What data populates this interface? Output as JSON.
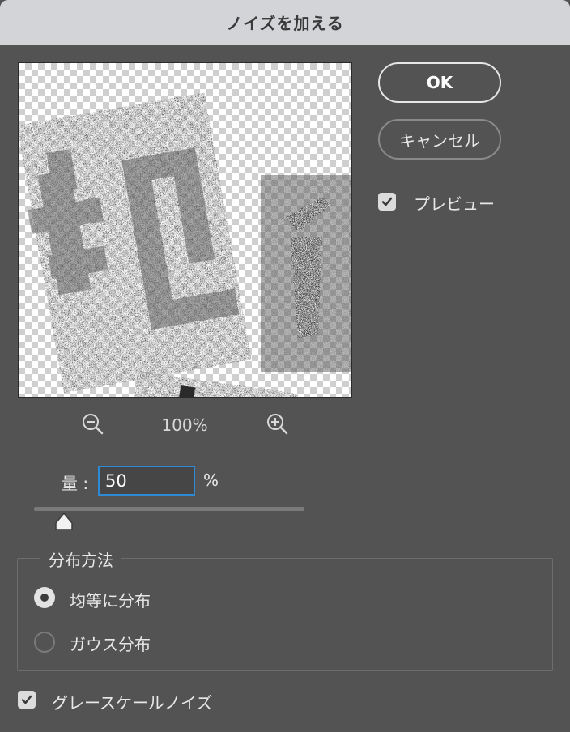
{
  "dialog": {
    "title": "ノイズを加える"
  },
  "buttons": {
    "ok": "OK",
    "cancel": "キャンセル"
  },
  "preview_toggle": {
    "label": "プレビュー",
    "checked": true
  },
  "zoom": {
    "level": "100%"
  },
  "amount": {
    "label": "量 :",
    "value": "50",
    "unit": "%",
    "slider_fraction": 0.11
  },
  "distribution": {
    "legend": "分布方法",
    "options": [
      {
        "label": "均等に分布",
        "selected": true
      },
      {
        "label": "ガウス分布",
        "selected": false
      }
    ]
  },
  "grayscale": {
    "label": "グレースケールノイズ",
    "checked": true
  },
  "colors": {
    "accent": "#2f8ad6",
    "panel": "#535353",
    "titlebar": "#d2d4d8"
  }
}
